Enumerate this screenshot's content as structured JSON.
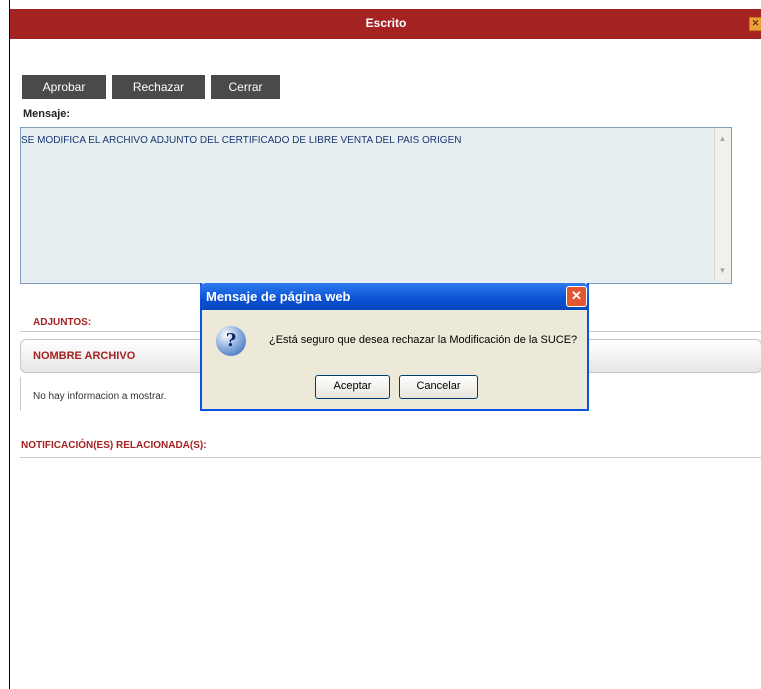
{
  "window": {
    "title": "Escrito",
    "close_glyph": "✕"
  },
  "toolbar": {
    "approve_label": "Aprobar",
    "reject_label": "Rechazar",
    "close_label": "Cerrar"
  },
  "message": {
    "label": "Mensaje:",
    "value": "SE MODIFICA EL ARCHIVO ADJUNTO DEL CERTIFICADO DE LIBRE VENTA DEL PAIS ORIGEN"
  },
  "attachments": {
    "title": "ADJUNTOS:",
    "column_header": "NOMBRE ARCHIVO",
    "empty_text": "No hay informacion a mostrar."
  },
  "notifications": {
    "title": "NOTIFICACIÓN(ES) RELACIONADA(S):"
  },
  "dialog": {
    "title": "Mensaje de página web",
    "question_glyph": "?",
    "message": "¿Está seguro que desea rechazar la Modificación de la SUCE?",
    "ok_label": "Aceptar",
    "cancel_label": "Cancelar",
    "close_glyph": "✕"
  },
  "icons": {
    "window_close": "close-icon",
    "dialog_close": "close-icon",
    "question": "question-icon",
    "scroll_up": "scroll-up-icon",
    "scroll_down": "scroll-down-icon"
  },
  "colors": {
    "titlebar": "#a52222",
    "section_title": "#a52222",
    "dialog_titlebar": "#0a50d4"
  }
}
